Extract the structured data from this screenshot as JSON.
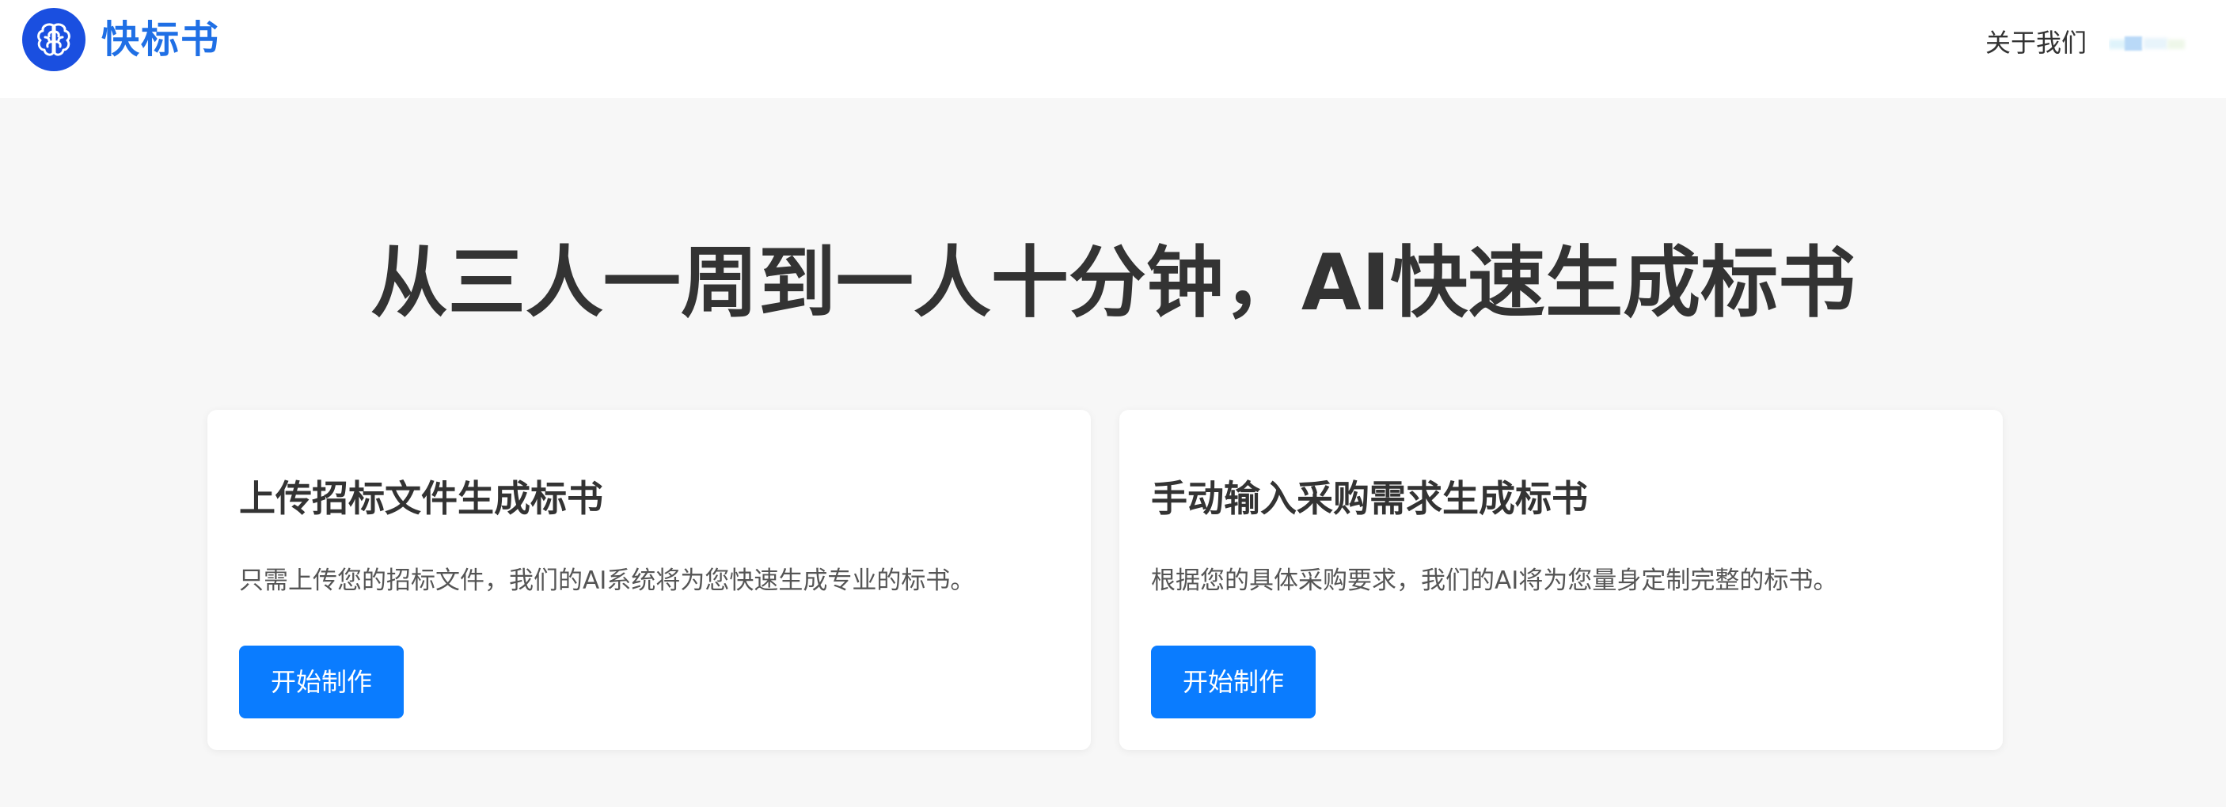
{
  "header": {
    "brand": "快标书",
    "logo_icon": "brain-icon",
    "logo_color": "#1a4fe0",
    "brand_color": "#1f6fe5",
    "nav": {
      "about": "关于我们"
    },
    "user_icon": "user-menu-icon"
  },
  "hero": {
    "title": "从三人一周到一人十分钟，AI快速生成标书"
  },
  "cards": [
    {
      "title": "上传招标文件生成标书",
      "description": "只需上传您的招标文件，我们的AI系统将为您快速生成专业的标书。",
      "button": "开始制作"
    },
    {
      "title": "手动输入采购需求生成标书",
      "description": "根据您的具体采购要求，我们的AI将为您量身定制完整的标书。",
      "button": "开始制作"
    }
  ],
  "colors": {
    "accent": "#0a7cff",
    "background": "#f7f7f7",
    "text": "#333333"
  }
}
